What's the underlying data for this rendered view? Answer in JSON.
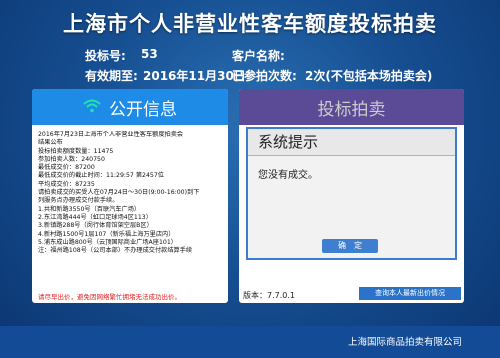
{
  "app": {
    "title": "上海市个人非营业性客车额度投标拍卖"
  },
  "info": {
    "bid_no_label": "投标号:",
    "bid_no_value": "53",
    "customer_label": "客户名称:",
    "customer_value": "",
    "valid_label": "有效期至:",
    "valid_value": "2016年11月30日",
    "count_label": "已参拍次数:",
    "count_value": "2次(不包括本场拍卖会)"
  },
  "left_panel": {
    "header": "公开信息",
    "icon": "wifi-icon",
    "notice_lines": [
      "2016年7月23日上海市个人非营业性客车额度拍卖会",
      "结果公布",
      "投标拍卖额度数量：11475",
      "参加拍卖人数：240750",
      "最低成交价：87200",
      "最低成交价的截止时间：11:29:57 第2457位",
      "平均成交价：87235",
      "请拍卖成交的买受人在07月24日～30日(9:00-16:00)到下",
      "列服务点办理成交付款手续。",
      "1.共和新路3550号（百联汽车广场）",
      "2.东江湾路444号（虹口足球场4区113）",
      "3.新镇路288号（闵行体育馆架空层B区）",
      "4.新村路1500号1层107（新乐福上海万里店内）",
      "5.浦东成山路800号（云顶国际商业广场A座101）",
      "注：福州路108号（公司本部）不办理成交付款结算手续"
    ],
    "warning": "请尽早出价，避免因网络繁忙拥堵无法成功出价。"
  },
  "right_panel": {
    "header": "投标拍卖",
    "dialog_title": "系统提示",
    "dialog_message": "您没有成交。",
    "confirm_label": "确　定",
    "version": "版本：7.7.0.1",
    "query_button": "查询本人最新出价情况"
  },
  "footer": {
    "company": "上海国际商品拍卖有限公司"
  }
}
